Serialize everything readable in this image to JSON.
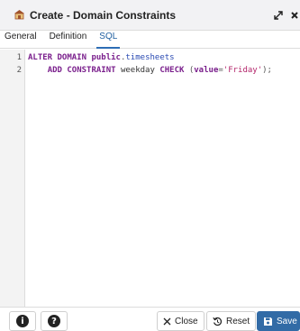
{
  "dialog": {
    "title": "Create - Domain Constraints"
  },
  "tabs": [
    {
      "label": "General",
      "active": false
    },
    {
      "label": "Definition",
      "active": false
    },
    {
      "label": "SQL",
      "active": true
    }
  ],
  "editor": {
    "line_numbers": [
      "1",
      "2"
    ],
    "line1": {
      "kw1": "ALTER DOMAIN",
      "space": " ",
      "kw2": "public",
      "dot": ".",
      "ident": "timesheets"
    },
    "line2": {
      "indent": "    ",
      "kw1": "ADD CONSTRAINT",
      "name": " weekday ",
      "kw2": "CHECK",
      "open": " (",
      "kw3": "value",
      "eq": "=",
      "str": "'Friday'",
      "close": ");"
    }
  },
  "footer": {
    "info_glyph": "i",
    "help_glyph": "?",
    "close_label": "Close",
    "reset_label": "Reset",
    "save_label": "Save"
  },
  "colors": {
    "accent": "#326ba6",
    "keyword": "#7a1f8c",
    "identifier": "#2b4bb3",
    "string": "#b3256a"
  },
  "icons": {
    "title": "domain-constraint-icon",
    "expand": "expand-arrows-icon",
    "close": "close-x-icon",
    "info": "info-icon",
    "help": "help-icon",
    "close_btn": "x-icon",
    "reset": "reset-icon",
    "save": "floppy-disk-icon"
  }
}
